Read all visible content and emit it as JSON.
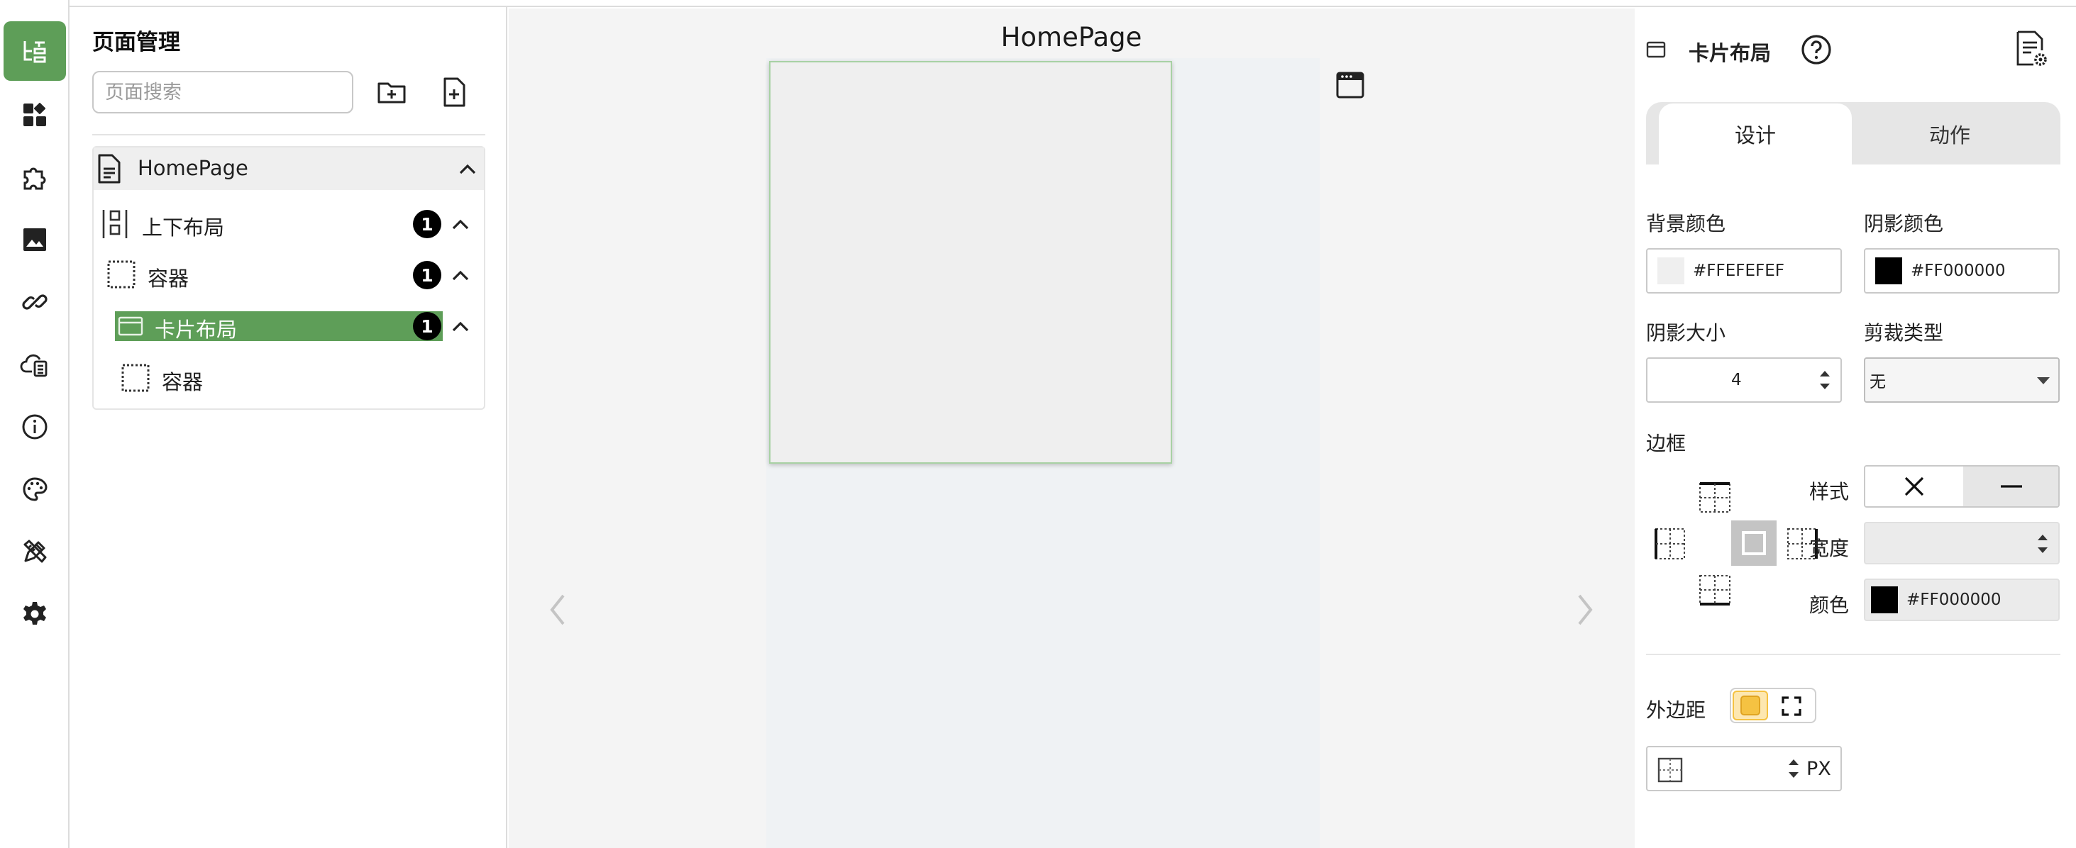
{
  "rail": {
    "items": [
      {
        "name": "page-tree-icon",
        "active": true
      },
      {
        "name": "components-icon"
      },
      {
        "name": "plugin-icon"
      },
      {
        "name": "image-icon"
      },
      {
        "name": "link-icon"
      },
      {
        "name": "cloud-data-icon"
      },
      {
        "name": "info-icon"
      },
      {
        "name": "palette-icon"
      },
      {
        "name": "design-tools-icon"
      },
      {
        "name": "settings-icon"
      }
    ]
  },
  "tree": {
    "title": "页面管理",
    "search_placeholder": "页面搜索",
    "root": {
      "label": "HomePage"
    },
    "nodes": [
      {
        "label": "上下布局",
        "count": "1"
      },
      {
        "label": "容器",
        "count": "1"
      },
      {
        "label": "卡片布局",
        "count": "1",
        "selected": true
      },
      {
        "label": "容器"
      }
    ]
  },
  "canvas": {
    "title": "HomePage"
  },
  "props": {
    "component_title": "卡片布局",
    "tabs": {
      "design": "设计",
      "action": "动作"
    },
    "bg_color_label": "背景颜色",
    "bg_color_value": "#FFEFEFEF",
    "shadow_color_label": "阴影颜色",
    "shadow_color_value": "#FF000000",
    "shadow_size_label": "阴影大小",
    "shadow_size_value": "4",
    "clip_type_label": "剪裁类型",
    "clip_type_value": "无",
    "border_label": "边框",
    "border_style_label": "样式",
    "border_width_label": "宽度",
    "border_color_label": "颜色",
    "border_color_value": "#FF000000",
    "margin_label": "外边距",
    "margin_unit": "PX"
  },
  "colors": {
    "accent": "#5e9e58",
    "margin_toggle": "#f5c242"
  }
}
